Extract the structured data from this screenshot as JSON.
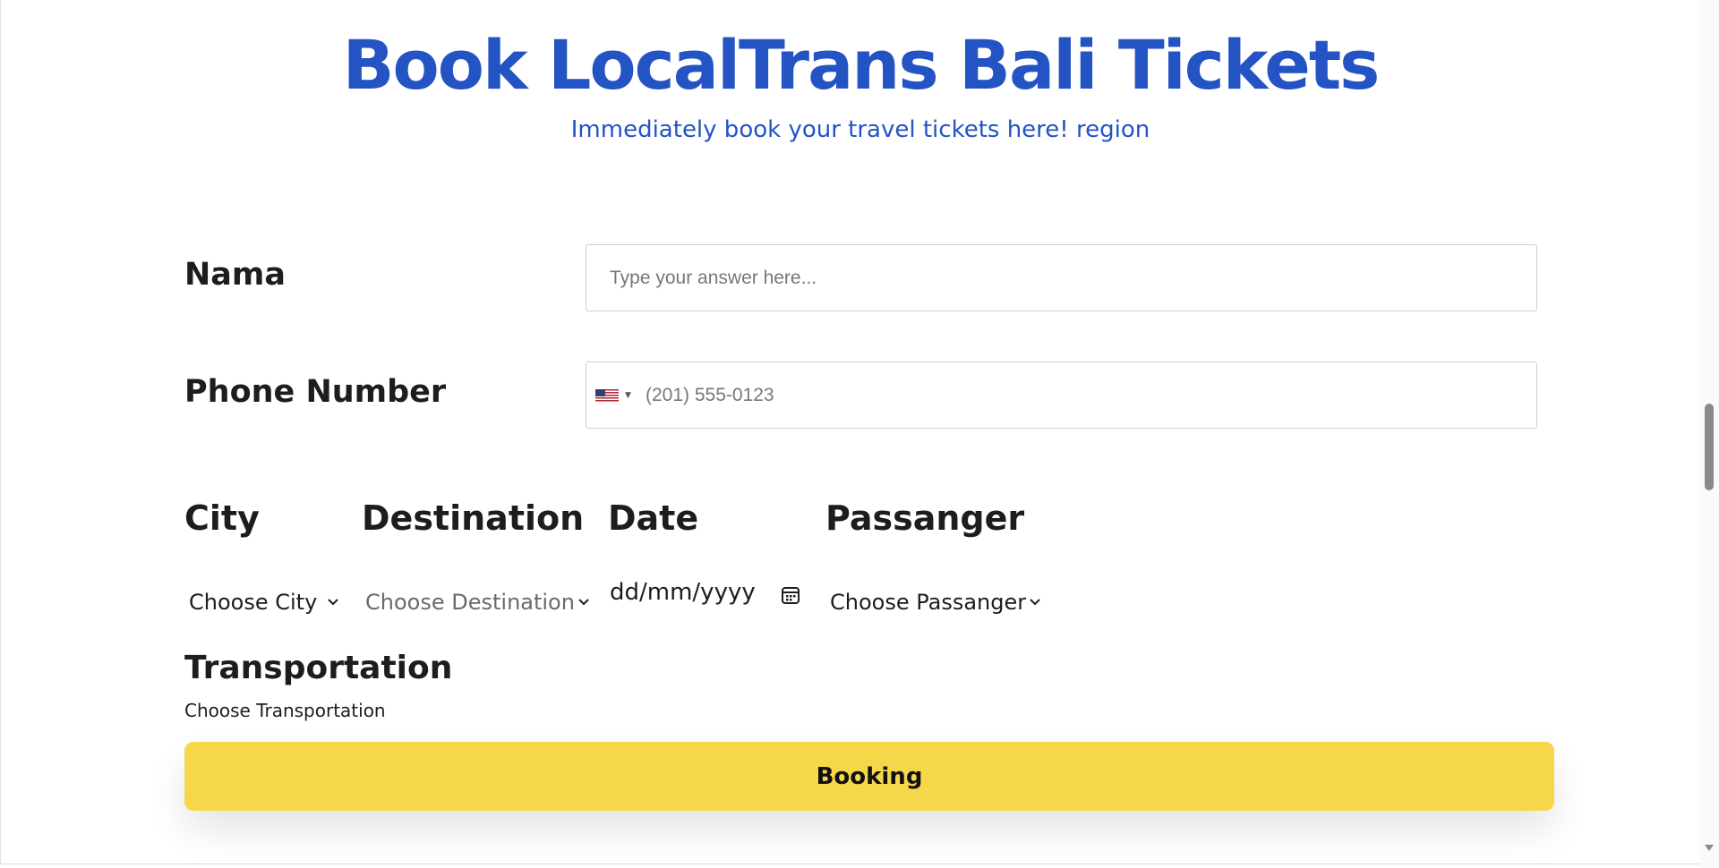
{
  "header": {
    "title": "Book LocalTrans Bali Tickets",
    "subtitle": "Immediately book your travel tickets here! region"
  },
  "form": {
    "name_label": "Nama",
    "name_placeholder": "Type your answer here...",
    "phone_label": "Phone Number",
    "phone_placeholder": "(201) 555-0123",
    "phone_country_icon": "us-flag-icon",
    "columns": {
      "city_label": "City",
      "city_value": "Choose City",
      "destination_label": "Destination",
      "destination_value": "Choose Destination",
      "date_label": "Date",
      "date_value": "dd/mm/yyyy",
      "passanger_label": "Passanger",
      "passanger_value": "Choose Passanger"
    },
    "transportation_label": "Transportation",
    "transportation_value": "Choose Transportation",
    "submit_label": "Booking"
  },
  "colors": {
    "accent": "#2453c4",
    "button": "#f7d74a",
    "text": "#1d1d1d"
  },
  "icons": {
    "chevron": "chevron-down-icon",
    "calendar": "calendar-icon"
  }
}
